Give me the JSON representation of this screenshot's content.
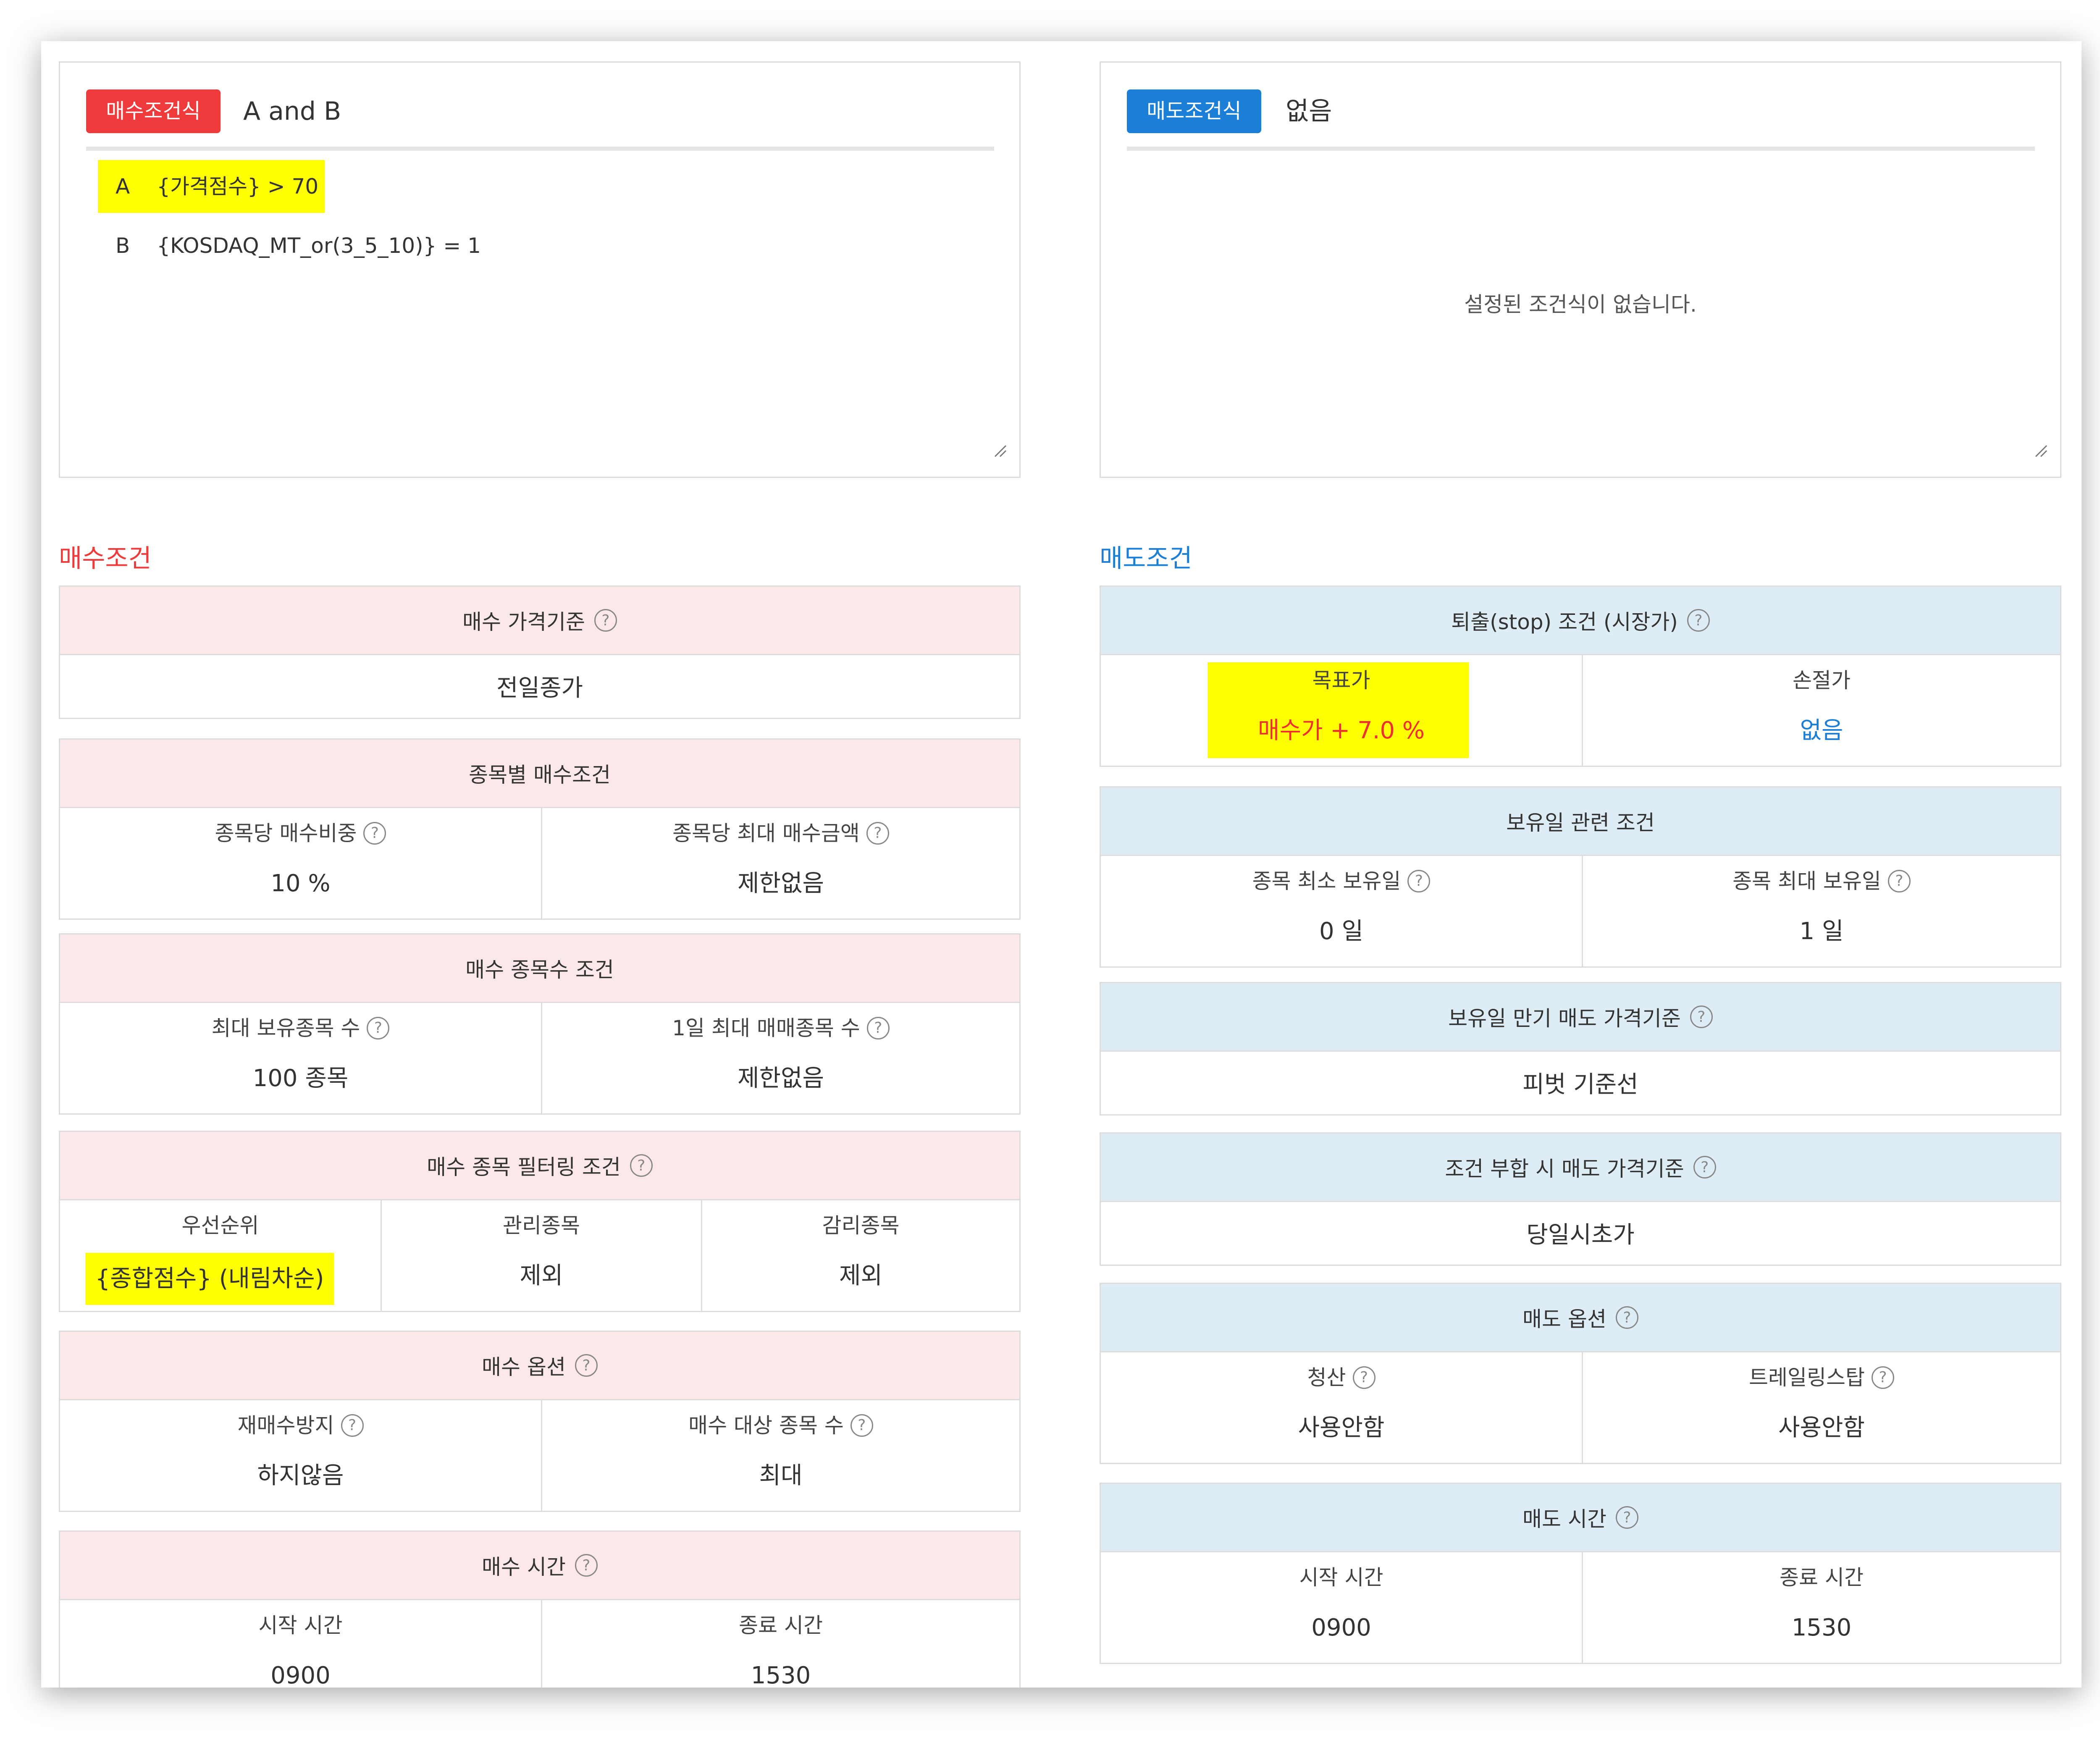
{
  "buy_expr": {
    "badge": "매수조건식",
    "title": "A and B",
    "conditions": [
      {
        "label": "A",
        "expr": "{가격점수} > 70"
      },
      {
        "label": "B",
        "expr": "{KOSDAQ_MT_or(3_5_10)} = 1"
      }
    ]
  },
  "sell_expr": {
    "badge": "매도조건식",
    "title": "없음",
    "empty_message": "설정된 조건식이 없습니다."
  },
  "buy_section": {
    "title": "매수조건",
    "price_basis": {
      "header": "매수 가격기준",
      "value": "전일종가"
    },
    "per_stock": {
      "header": "종목별 매수조건",
      "cells": [
        {
          "label": "종목당 매수비중",
          "value": "10 %"
        },
        {
          "label": "종목당 최대 매수금액",
          "value": "제한없음"
        }
      ]
    },
    "count": {
      "header": "매수 종목수 조건",
      "cells": [
        {
          "label": "최대 보유종목 수",
          "value": "100 종목"
        },
        {
          "label": "1일 최대 매매종목 수",
          "value": "제한없음"
        }
      ]
    },
    "filter": {
      "header": "매수 종목 필터링 조건",
      "cells": [
        {
          "label": "우선순위",
          "value": "{종합점수} (내림차순)"
        },
        {
          "label": "관리종목",
          "value": "제외"
        },
        {
          "label": "감리종목",
          "value": "제외"
        }
      ]
    },
    "options": {
      "header": "매수 옵션",
      "cells": [
        {
          "label": "재매수방지",
          "value": "하지않음"
        },
        {
          "label": "매수 대상 종목 수",
          "value": "최대"
        }
      ]
    },
    "time": {
      "header": "매수 시간",
      "cells": [
        {
          "label": "시작 시간",
          "value": "0900"
        },
        {
          "label": "종료 시간",
          "value": "1530"
        }
      ]
    }
  },
  "sell_section": {
    "title": "매도조건",
    "stop": {
      "header": "퇴출(stop) 조건 (시장가)",
      "cells": [
        {
          "label": "목표가",
          "value": "매수가 + 7.0 %"
        },
        {
          "label": "손절가",
          "value": "없음"
        }
      ]
    },
    "holding": {
      "header": "보유일 관련 조건",
      "cells": [
        {
          "label": "종목 최소 보유일",
          "value": "0 일"
        },
        {
          "label": "종목 최대 보유일",
          "value": "1 일"
        }
      ]
    },
    "expiry": {
      "header": "보유일 만기 매도 가격기준",
      "value": "피벗 기준선"
    },
    "match": {
      "header": "조건 부합 시 매도 가격기준",
      "value": "당일시초가"
    },
    "options": {
      "header": "매도 옵션",
      "cells": [
        {
          "label": "청산",
          "value": "사용안함"
        },
        {
          "label": "트레일링스탑",
          "value": "사용안함"
        }
      ]
    },
    "time": {
      "header": "매도 시간",
      "cells": [
        {
          "label": "시작 시간",
          "value": "0900"
        },
        {
          "label": "종료 시간",
          "value": "1530"
        }
      ]
    }
  },
  "colors": {
    "buy_accent": "#ef3b3b",
    "sell_accent": "#1b7fd8",
    "highlight": "#ffff00",
    "buy_header_bg": "#fce8e8",
    "sell_header_bg": "#ddecf5"
  },
  "icons": {
    "help": "question-circle-icon",
    "resize": "resize-handle-icon"
  }
}
